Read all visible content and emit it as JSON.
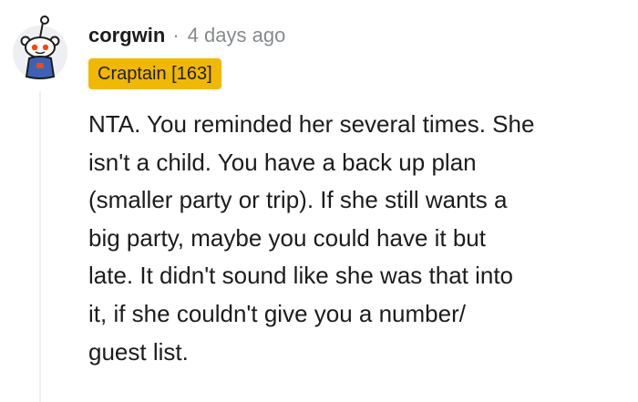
{
  "comment": {
    "author": "corgwin",
    "separator": "·",
    "timestamp": "4 days ago",
    "flair": "Craptain [163]",
    "avatar_icon": "snoo-avatar-icon",
    "body_lines": [
      "NTA. You reminded her several times. She",
      "isn't a child. You have a back up plan",
      "(smaller party or trip). If she still wants a",
      "big party, maybe you could have it but",
      "late. It didn't sound like she was that into",
      "it, if she couldn't give you a number/",
      "guest list."
    ]
  },
  "colors": {
    "text": "#1c1c1c",
    "meta": "#878a8c",
    "flair_bg": "#f0b800",
    "thread_line": "#edeff1",
    "avatar_bg": "#edeff1",
    "snoo_shirt": "#3b62b7",
    "snoo_eye": "#ff4500",
    "snoo_logo": "#ff4500"
  }
}
